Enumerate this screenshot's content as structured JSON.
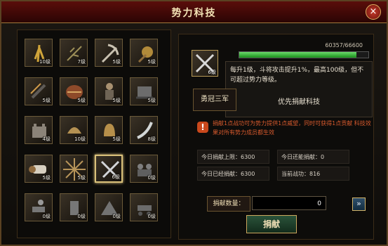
{
  "window": {
    "title": "势力科技",
    "close_label": "×"
  },
  "grid": {
    "cells": [
      {
        "id": "c1",
        "level": "10级"
      },
      {
        "id": "c2",
        "level": "7级"
      },
      {
        "id": "c3",
        "level": "5级"
      },
      {
        "id": "c4",
        "level": "5级"
      },
      {
        "id": "c5",
        "level": "5级"
      },
      {
        "id": "c6",
        "level": "5级"
      },
      {
        "id": "c7",
        "level": "5级"
      },
      {
        "id": "c8",
        "level": "5级"
      },
      {
        "id": "c9",
        "level": "4级"
      },
      {
        "id": "c10",
        "level": "10级"
      },
      {
        "id": "c11",
        "level": "5级"
      },
      {
        "id": "c12",
        "level": "8级"
      },
      {
        "id": "c13",
        "level": "5级"
      },
      {
        "id": "c14",
        "level": "5级"
      },
      {
        "id": "c15",
        "level": "6级"
      },
      {
        "id": "c16",
        "level": "0级"
      },
      {
        "id": "c17",
        "level": "0级"
      },
      {
        "id": "c18",
        "level": "0级"
      },
      {
        "id": "c19",
        "level": "0级"
      },
      {
        "id": "c20",
        "level": "0级"
      }
    ]
  },
  "tech": {
    "level": "6级",
    "progress_text": "60357/66600",
    "progress_ratio": 0.906,
    "description": "每升1级，斗将攻击提升1%，最高100级，但不可超过势力等级。",
    "priority": "优先捐献科技",
    "name": "勇冠三军"
  },
  "warning": {
    "text": "捐献1点战功可为势力提供1点威望，同时可获得1点贡献 科技效果对所有势力成员都生效"
  },
  "stats": {
    "today_limit": "今日捐献上限：6300",
    "today_available": "今日还能捐献：0",
    "today_donated": "今日已经捐献：6300",
    "current_merit": "当前战功：816"
  },
  "donate": {
    "label": "捐献数量：",
    "value": "0",
    "button": "捐献",
    "arrow": "»"
  },
  "colors": {
    "accent_red": "#c9481c",
    "gold": "#d9c07a",
    "progress_green": "#198f1b"
  }
}
